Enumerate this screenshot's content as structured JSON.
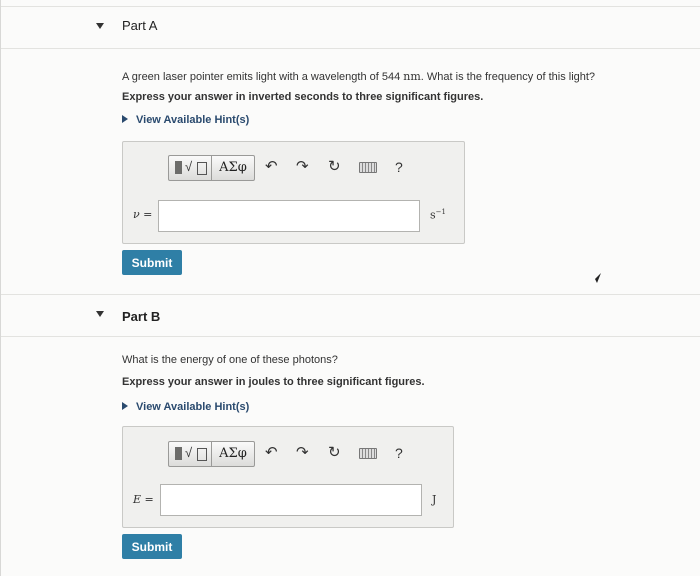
{
  "partA": {
    "title": "Part A",
    "question_text": "A green laser pointer emits light with a wavelength of 544 ",
    "question_unit": "nm",
    "question_tail": ". What is the frequency of this light?",
    "instruction": "Express your answer in inverted seconds to three significant figures.",
    "hint": "View Available Hint(s)",
    "variable": "ν =",
    "input_value": "",
    "unit_base": "s",
    "unit_exp": "−1",
    "submit": "Submit"
  },
  "partB": {
    "title": "Part B",
    "question_text": "What is the energy of one of these photons?",
    "instruction": "Express your answer in joules to three significant figures.",
    "hint": "View Available Hint(s)",
    "variable": "E =",
    "input_value": "",
    "unit": "J",
    "submit": "Submit"
  },
  "toolbar": {
    "greek_label": "ΑΣφ",
    "radical_label": "√",
    "undo_icon": "undo-icon",
    "redo_icon": "redo-icon",
    "reset_icon": "reset-icon",
    "keyboard_icon": "keyboard-icon",
    "help_label": "?"
  },
  "colors": {
    "submit_bg": "#2f7fa6",
    "hint_text": "#2a4a6e",
    "page_bg": "#fbfbfa"
  }
}
